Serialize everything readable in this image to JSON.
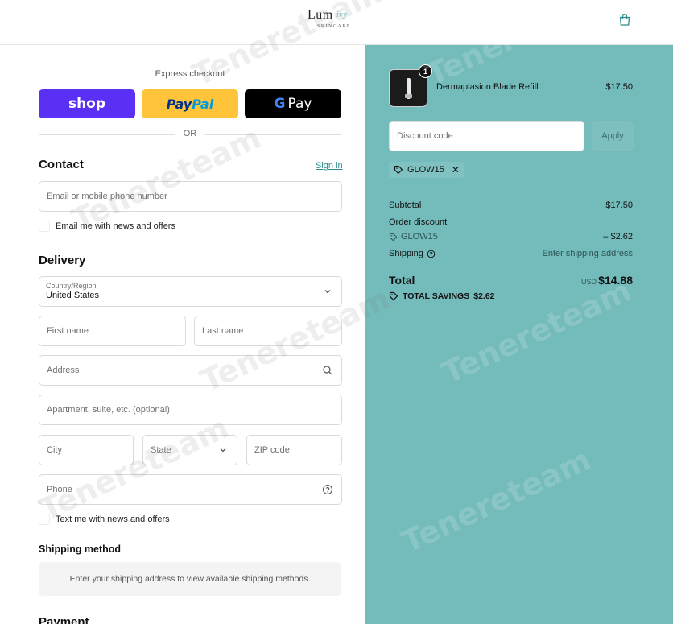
{
  "header": {
    "logo_main": "Lum",
    "logo_script": "ivy",
    "logo_sub": "SKINCARE"
  },
  "express": {
    "label": "Express checkout",
    "shop": "shop",
    "paypal_a": "Pay",
    "paypal_b": "Pal",
    "gpay_g": "G",
    "gpay_text": "Pay",
    "or": "OR"
  },
  "contact": {
    "title": "Contact",
    "sign_in": "Sign in",
    "email_placeholder": "Email or mobile phone number",
    "news_label": "Email me with news and offers"
  },
  "delivery": {
    "title": "Delivery",
    "country_label": "Country/Region",
    "country_value": "United States",
    "first_name": "First name",
    "last_name": "Last name",
    "address": "Address",
    "apartment": "Apartment, suite, etc. (optional)",
    "city": "City",
    "state": "State",
    "zip": "ZIP code",
    "phone": "Phone",
    "sms_label": "Text me with news and offers"
  },
  "shipping": {
    "title": "Shipping method",
    "message": "Enter your shipping address to view available shipping methods."
  },
  "payment": {
    "title": "Payment"
  },
  "summary": {
    "product_name": "Dermaplasion Blade Refill",
    "product_price": "$17.50",
    "quantity": "1",
    "discount_placeholder": "Discount code",
    "apply": "Apply",
    "applied_code": "GLOW15",
    "subtotal_label": "Subtotal",
    "subtotal_value": "$17.50",
    "order_discount_label": "Order discount",
    "discount_code": "GLOW15",
    "discount_value": "– $2.62",
    "shipping_label": "Shipping",
    "shipping_value": "Enter shipping address",
    "total_label": "Total",
    "currency": "USD",
    "total_value": "$14.88",
    "savings_label": "TOTAL SAVINGS",
    "savings_value": "$2.62"
  },
  "watermark": "Tenereteam",
  "colors": {
    "summary_bg": "#74bbbb",
    "shop_pay": "#5a31f4",
    "paypal": "#ffc439",
    "link": "#2d8b8b"
  }
}
